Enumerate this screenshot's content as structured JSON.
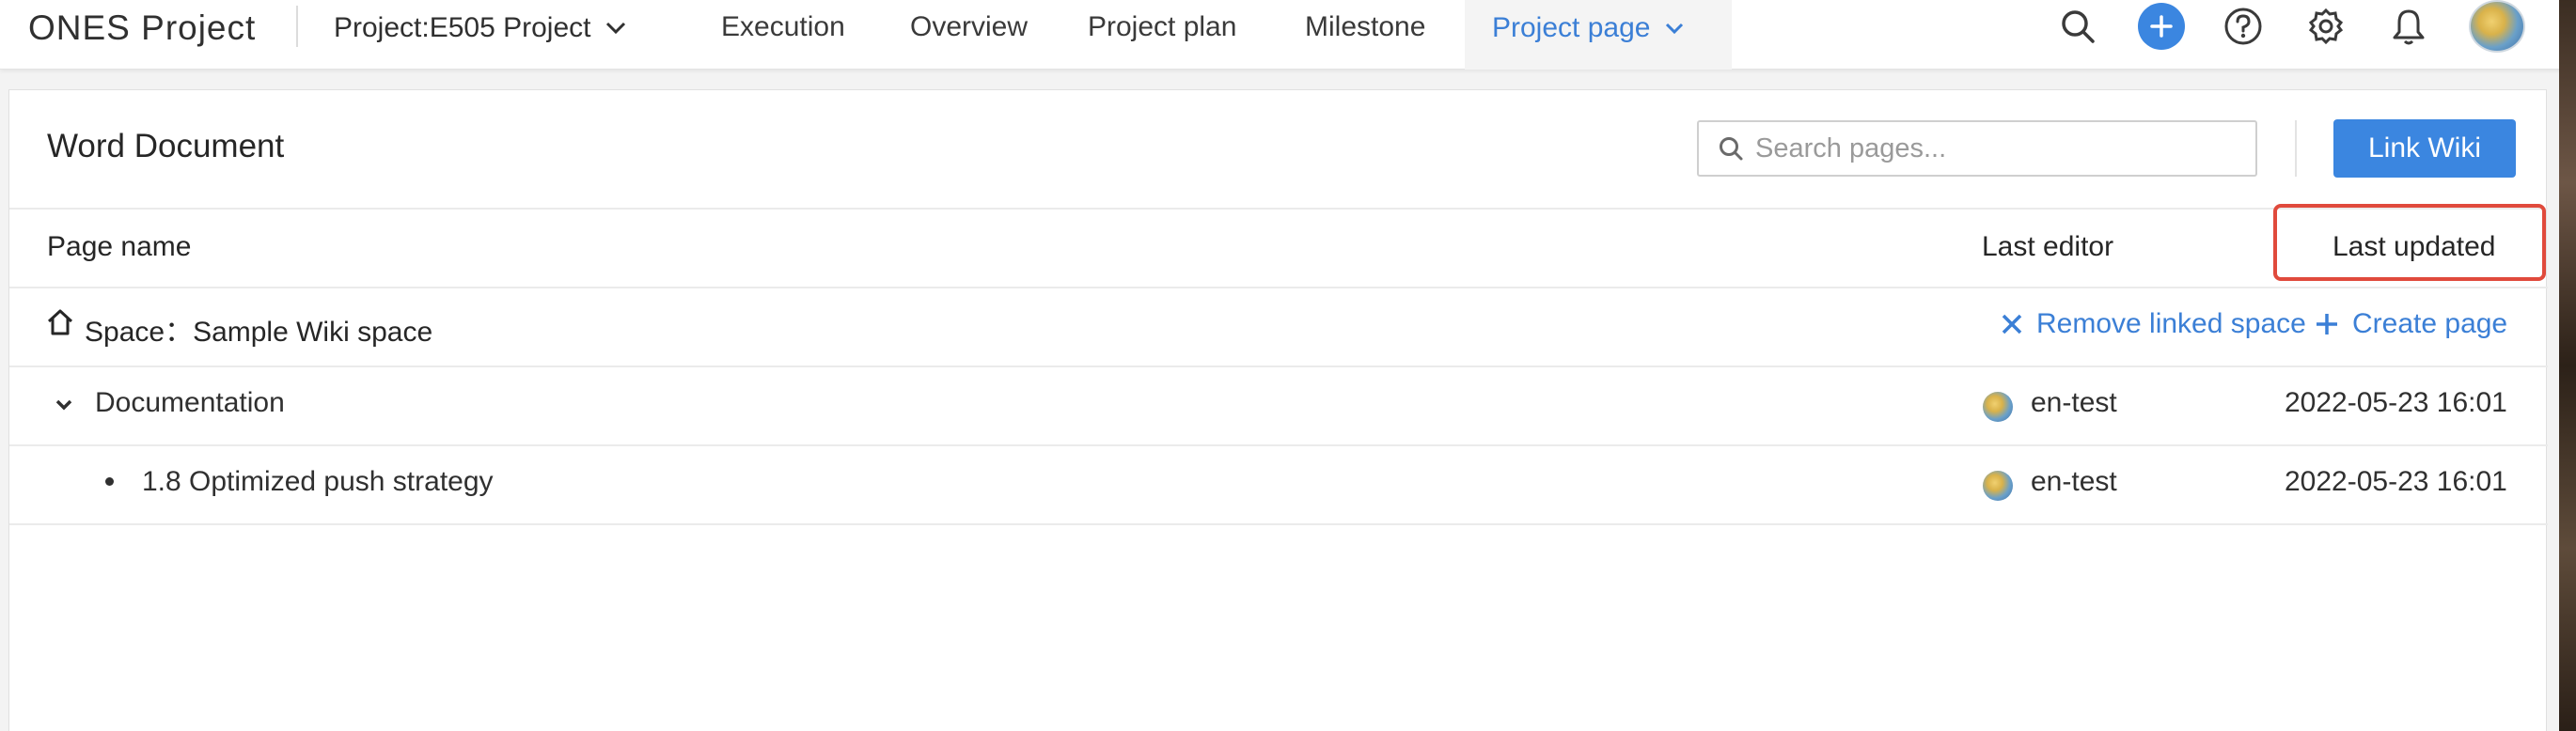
{
  "topbar": {
    "brand": "ONES Project",
    "project": "Project:E505 Project",
    "nav": [
      "Execution",
      "Overview",
      "Project plan",
      "Milestone",
      "Project page"
    ],
    "icons": [
      "search-icon",
      "add-circle-icon",
      "help-icon",
      "gear-icon",
      "bell-icon",
      "avatar"
    ]
  },
  "page": {
    "title": "Word Document",
    "search_placeholder": "Search pages...",
    "link_wiki": "Link Wiki",
    "columns": [
      "Page name",
      "Last editor",
      "Last updated"
    ],
    "space": {
      "label": "Space：Sample Wiki space",
      "remove": "Remove linked space",
      "create": "Create page"
    },
    "rows": [
      {
        "name": "Documentation",
        "editor": "en-test",
        "updated": "2022-05-23 16:01"
      },
      {
        "name": "1.8 Optimized push strategy",
        "editor": "en-test",
        "updated": "2022-05-23 16:01"
      }
    ]
  },
  "colors": {
    "accent": "#3b86e0",
    "link": "#3b7fd6",
    "highlight": "#e04a3c"
  }
}
